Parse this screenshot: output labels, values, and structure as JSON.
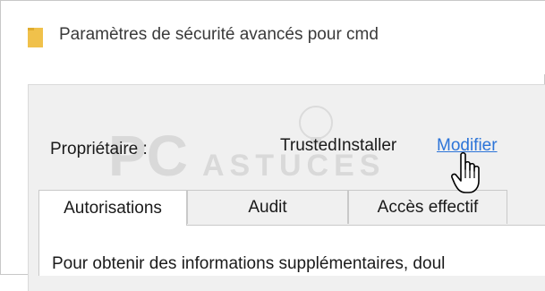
{
  "window": {
    "title": "Paramètres de sécurité avancés pour cmd",
    "icon": "folder-icon"
  },
  "owner": {
    "label": "Propriétaire :",
    "value": "TrustedInstaller",
    "link": "Modifier"
  },
  "tabs": [
    {
      "label": "Autorisations",
      "active": true
    },
    {
      "label": "Audit",
      "active": false
    },
    {
      "label": "Accès effectif",
      "active": false
    }
  ],
  "panel": {
    "text": "Pour obtenir des informations supplémentaires, doul"
  },
  "watermark": {
    "line1": "PC",
    "line2": "ASTUCES"
  },
  "colors": {
    "link": "#2c74d8",
    "folder": "#f0c14b",
    "panel_bg": "#f0f0f0"
  }
}
